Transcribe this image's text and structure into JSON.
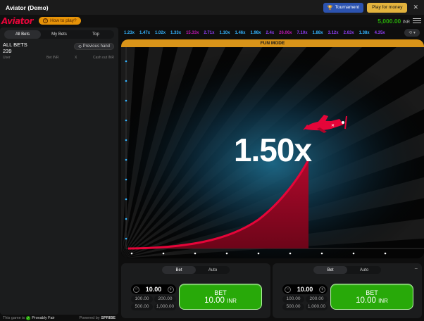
{
  "window": {
    "title": "Aviator (Demo)",
    "tournament_label": "Tournament",
    "play_label": "Play for money"
  },
  "header": {
    "logo_text": "Aviator",
    "how_to_play": "How to play?",
    "balance": "5,000.00",
    "currency": "INR"
  },
  "left_panel": {
    "tabs": [
      "All Bets",
      "My Bets",
      "Top"
    ],
    "all_bets_title": "ALL BETS",
    "all_bets_count": "239",
    "previous_hand": "Previous hand",
    "columns": {
      "user": "User",
      "bet": "Bet INR",
      "x": "X",
      "cashout": "Cash out INR"
    }
  },
  "footer": {
    "game_is": "This game is",
    "provably_fair": "Provably Fair",
    "powered_by": "Powered by",
    "brand": "SPRIBE"
  },
  "history": [
    {
      "value": "1.23x",
      "color": "#34b4ff"
    },
    {
      "value": "1.47x",
      "color": "#34b4ff"
    },
    {
      "value": "1.02x",
      "color": "#34b4ff"
    },
    {
      "value": "1.33x",
      "color": "#34b4ff"
    },
    {
      "value": "15.33x",
      "color": "#c017b4"
    },
    {
      "value": "2.71x",
      "color": "#913ef8"
    },
    {
      "value": "1.10x",
      "color": "#34b4ff"
    },
    {
      "value": "1.46x",
      "color": "#34b4ff"
    },
    {
      "value": "1.98x",
      "color": "#34b4ff"
    },
    {
      "value": "2.4x",
      "color": "#913ef8"
    },
    {
      "value": "26.06x",
      "color": "#c017b4"
    },
    {
      "value": "7.10x",
      "color": "#913ef8"
    },
    {
      "value": "1.88x",
      "color": "#34b4ff"
    },
    {
      "value": "3.12x",
      "color": "#913ef8"
    },
    {
      "value": "2.63x",
      "color": "#913ef8"
    },
    {
      "value": "1.38x",
      "color": "#34b4ff"
    },
    {
      "value": "4.35x",
      "color": "#913ef8"
    }
  ],
  "game": {
    "mode_label": "FUN MODE",
    "multiplier": "1.50x"
  },
  "bet_panels": [
    {
      "tab_bet": "Bet",
      "tab_auto": "Auto",
      "amount": "10.00",
      "quick": [
        "100.00",
        "200.00",
        "500.00",
        "1,000.00"
      ],
      "btn_line1": "BET",
      "btn_amount": "10.00",
      "btn_currency": "INR"
    },
    {
      "tab_bet": "Bet",
      "tab_auto": "Auto",
      "amount": "10.00",
      "quick": [
        "100.00",
        "200.00",
        "500.00",
        "1,000.00"
      ],
      "btn_line1": "BET",
      "btn_amount": "10.00",
      "btn_currency": "INR"
    }
  ],
  "colors": {
    "accent_red": "#e50539",
    "bet_green": "#28a909",
    "fun_mode": "#d99419"
  }
}
